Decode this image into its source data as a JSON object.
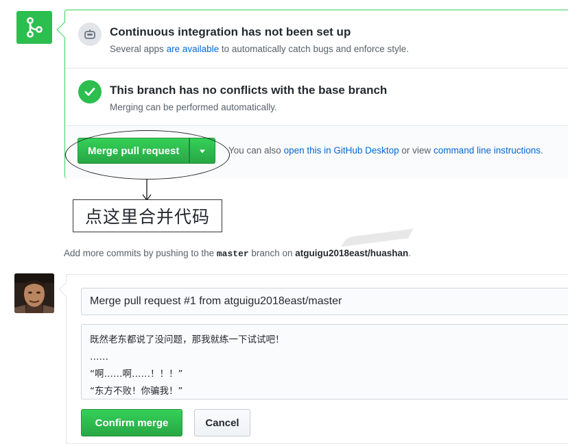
{
  "icons": {
    "merge": "git-merge-icon",
    "ci": "robot-icon",
    "check": "check-icon",
    "caret": "triangle-down-icon",
    "arrow": "arrow-down-icon"
  },
  "colors": {
    "green": "#2cbe4e",
    "link": "#0366d6"
  },
  "ci_status": {
    "title": "Continuous integration has not been set up",
    "sub_prefix": "Several apps ",
    "sub_link": "are available",
    "sub_suffix": " to automatically catch bugs and enforce style."
  },
  "conflict_status": {
    "title": "This branch has no conflicts with the base branch",
    "sub": "Merging can be performed automatically."
  },
  "merge_actions": {
    "merge_button": "Merge pull request",
    "prefix": "You can also ",
    "desktop_link": "open this in GitHub Desktop",
    "middle": " or view ",
    "cli_link": "command line instructions",
    "suffix": "."
  },
  "annotation": {
    "note": "点这里合并代码"
  },
  "hint": {
    "prefix": "Add more commits by pushing to the ",
    "branch": "master",
    "middle": " branch on ",
    "repo": "atguigu2018east/huashan",
    "suffix": "."
  },
  "commit_form": {
    "title": "Merge pull request #1 from atguigu2018east/master",
    "body_lines": [
      "既然老东都说了没问题，那我就练一下试试吧！",
      "……",
      "“啊……啊……！！！”",
      "“东方不败！你骗我！”"
    ],
    "confirm_button": "Confirm merge",
    "cancel_button": "Cancel"
  }
}
